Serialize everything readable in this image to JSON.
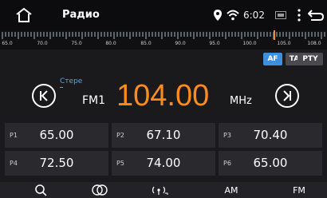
{
  "status": {
    "title": "Радио",
    "time": "6:02"
  },
  "scale": {
    "labels": [
      "65.0",
      "70.0",
      "75.0",
      "80.0",
      "85.0",
      "90.0",
      "95.0",
      "100.0",
      "105.0",
      "108.0"
    ]
  },
  "rds": {
    "af": "AF",
    "ta": "TA",
    "pty": "PTY"
  },
  "tuner": {
    "stereo": "Стере",
    "band": "FM1",
    "frequency": "104.00",
    "unit": "MHz"
  },
  "presets": [
    {
      "label": "P1",
      "value": "65.00"
    },
    {
      "label": "P2",
      "value": "67.10"
    },
    {
      "label": "P3",
      "value": "70.40"
    },
    {
      "label": "P4",
      "value": "72.50"
    },
    {
      "label": "P5",
      "value": "74.00"
    },
    {
      "label": "P6",
      "value": "65.00"
    }
  ],
  "toolbar": {
    "am": "AM",
    "fm": "FM"
  },
  "icons": {
    "home": "home-icon",
    "location": "location-icon",
    "wifi": "wifi-icon",
    "screen": "screen-icon",
    "menu": "menu-dots-icon",
    "back": "back-icon",
    "prev": "seek-prev-icon",
    "next": "seek-next-icon",
    "search": "search-icon",
    "stereo": "stereo-icon",
    "antenna": "antenna-icon"
  },
  "colors": {
    "accent": "#ff8c1a",
    "highlight": "#3d8fe0",
    "stereo": "#4aa7ff"
  }
}
